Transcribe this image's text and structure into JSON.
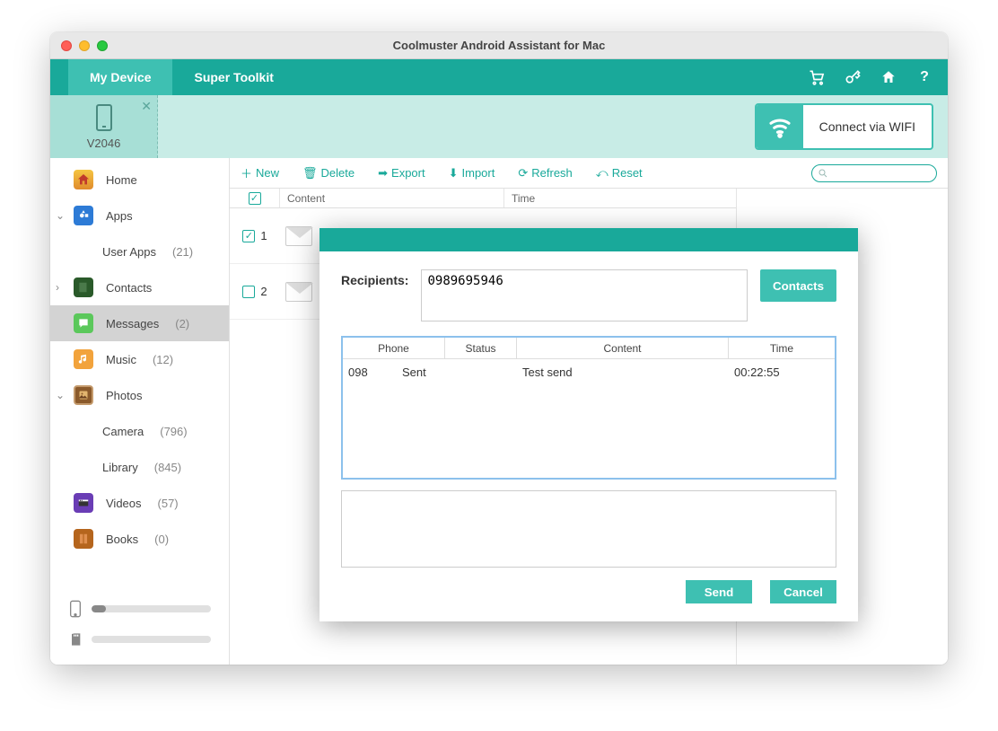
{
  "window": {
    "title": "Coolmuster Android Assistant for Mac"
  },
  "tabs": {
    "myDevice": "My Device",
    "superToolkit": "Super Toolkit"
  },
  "device": {
    "name": "V2046",
    "wifiLabel": "Connect via WIFI"
  },
  "sidebar": {
    "home": "Home",
    "apps": "Apps",
    "userApps": "User Apps",
    "userAppsCount": "(21)",
    "contacts": "Contacts",
    "messages": "Messages",
    "messagesCount": "(2)",
    "music": "Music",
    "musicCount": "(12)",
    "photos": "Photos",
    "camera": "Camera",
    "cameraCount": "(796)",
    "library": "Library",
    "libraryCount": "(845)",
    "videos": "Videos",
    "videosCount": "(57)",
    "books": "Books",
    "booksCount": "(0)"
  },
  "toolbar": {
    "new": "New",
    "delete": "Delete",
    "export": "Export",
    "import": "Import",
    "refresh": "Refresh",
    "reset": "Reset"
  },
  "listHeader": {
    "content": "Content",
    "time": "Time"
  },
  "messages": {
    "row1num": "1",
    "row2num": "2"
  },
  "modal": {
    "recipientsLabel": "Recipients:",
    "recipientsValue": "0989695946",
    "contactsBtn": "Contacts",
    "cols": {
      "phone": "Phone",
      "status": "Status",
      "content": "Content",
      "time": "Time"
    },
    "row": {
      "phone": "098",
      "status": "Sent",
      "content": "Test send",
      "time": "00:22:55"
    },
    "send": "Send",
    "cancel": "Cancel"
  },
  "storage": {
    "internalPct": 12,
    "sdPct": 0
  }
}
